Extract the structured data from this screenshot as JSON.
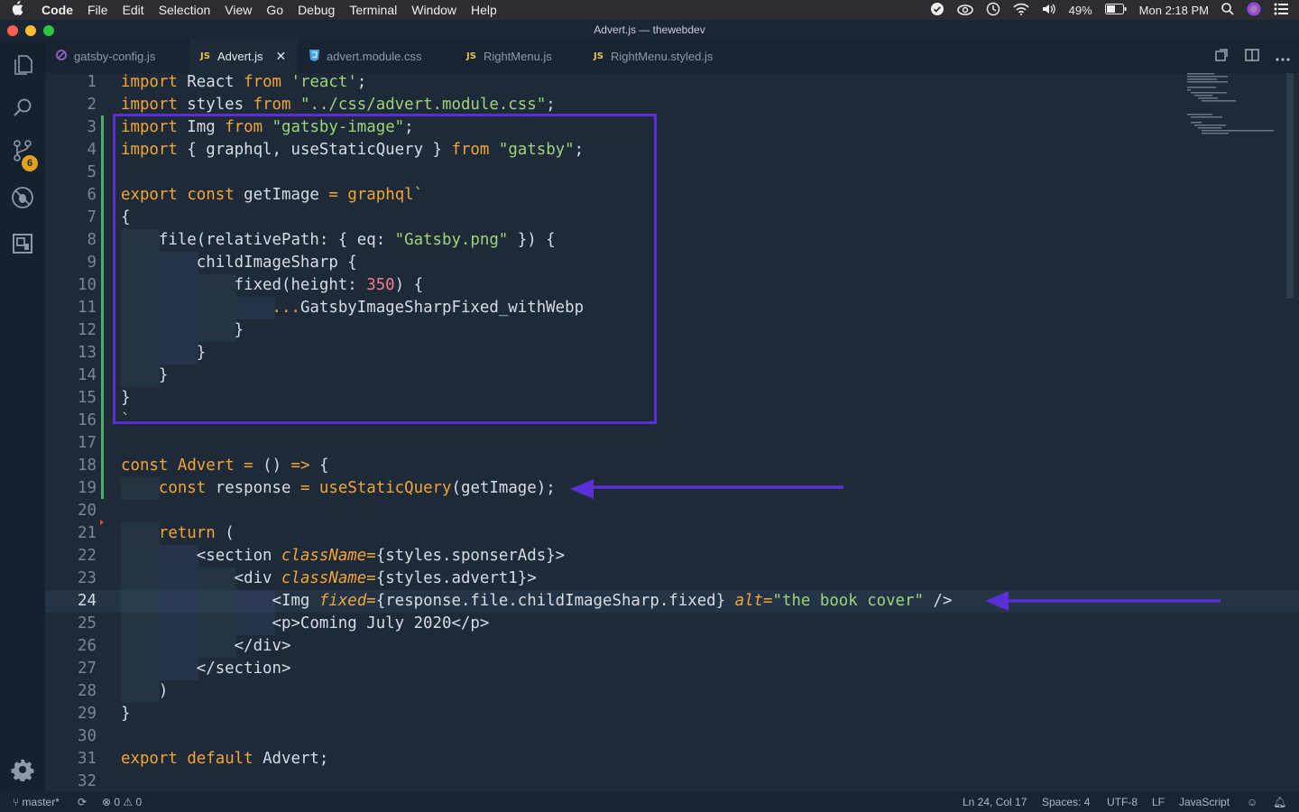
{
  "menubar": {
    "apple_icon": "apple-logo",
    "items": [
      "Code",
      "File",
      "Edit",
      "Selection",
      "View",
      "Go",
      "Debug",
      "Terminal",
      "Window",
      "Help"
    ],
    "battery": "49%",
    "clock": "Mon 2:18 PM"
  },
  "window": {
    "title": "Advert.js — thewebdev"
  },
  "activity": {
    "scm_badge": "6"
  },
  "tabs": [
    {
      "label": "gatsby-config.js",
      "icon": "gatsby-icon",
      "icon_text": ""
    },
    {
      "label": "Advert.js",
      "icon": "js-icon",
      "icon_text": "JS",
      "active": true
    },
    {
      "label": "advert.module.css",
      "icon": "css-icon",
      "icon_text": ""
    },
    {
      "label": "RightMenu.js",
      "icon": "js-icon",
      "icon_text": "JS"
    },
    {
      "label": "RightMenu.styled.js",
      "icon": "js-icon",
      "icon_text": "JS"
    }
  ],
  "editor": {
    "current_line": 24,
    "lines": [
      [
        [
          "kw",
          "import"
        ],
        [
          "plain",
          " React "
        ],
        [
          "kw",
          "from"
        ],
        [
          "plain",
          " "
        ],
        [
          "str",
          "'react'"
        ],
        [
          "plain",
          ";"
        ]
      ],
      [
        [
          "kw",
          "import"
        ],
        [
          "plain",
          " styles "
        ],
        [
          "kw",
          "from"
        ],
        [
          "plain",
          " "
        ],
        [
          "str",
          "\"../css/advert.module.css\""
        ],
        [
          "plain",
          ";"
        ]
      ],
      [
        [
          "kw",
          "import"
        ],
        [
          "plain",
          " Img "
        ],
        [
          "kw",
          "from"
        ],
        [
          "plain",
          " "
        ],
        [
          "str",
          "\"gatsby-image\""
        ],
        [
          "plain",
          ";"
        ]
      ],
      [
        [
          "kw",
          "import"
        ],
        [
          "plain",
          " { graphql, useStaticQuery } "
        ],
        [
          "kw",
          "from"
        ],
        [
          "plain",
          " "
        ],
        [
          "str",
          "\"gatsby\""
        ],
        [
          "plain",
          ";"
        ]
      ],
      [],
      [
        [
          "kw",
          "export"
        ],
        [
          "plain",
          " "
        ],
        [
          "kw",
          "const"
        ],
        [
          "plain",
          " getImage "
        ],
        [
          "kw",
          "="
        ],
        [
          "plain",
          " "
        ],
        [
          "fn",
          "graphql"
        ],
        [
          "str",
          "`"
        ]
      ],
      [
        [
          "plain",
          "{"
        ]
      ],
      [
        [
          "plain",
          "    file(relativePath: { eq: "
        ],
        [
          "str",
          "\"Gatsby.png\""
        ],
        [
          "plain",
          " }) {"
        ]
      ],
      [
        [
          "plain",
          "        childImageSharp {"
        ]
      ],
      [
        [
          "plain",
          "            fixed(height: "
        ],
        [
          "num",
          "350"
        ],
        [
          "plain",
          ") {"
        ]
      ],
      [
        [
          "plain",
          "                "
        ],
        [
          "kw",
          "..."
        ],
        [
          "plain",
          "GatsbyImageSharpFixed_withWebp"
        ]
      ],
      [
        [
          "plain",
          "            }"
        ]
      ],
      [
        [
          "plain",
          "        }"
        ]
      ],
      [
        [
          "plain",
          "    }"
        ]
      ],
      [
        [
          "plain",
          "}"
        ]
      ],
      [
        [
          "str",
          "`"
        ]
      ],
      [],
      [
        [
          "kw",
          "const"
        ],
        [
          "plain",
          " "
        ],
        [
          "fn",
          "Advert"
        ],
        [
          "plain",
          " "
        ],
        [
          "kw",
          "="
        ],
        [
          "plain",
          " () "
        ],
        [
          "kw",
          "=>"
        ],
        [
          "plain",
          " {"
        ]
      ],
      [
        [
          "plain",
          "    "
        ],
        [
          "kw",
          "const"
        ],
        [
          "plain",
          " response "
        ],
        [
          "kw",
          "="
        ],
        [
          "plain",
          " "
        ],
        [
          "fn",
          "useStaticQuery"
        ],
        [
          "plain",
          "(getImage);"
        ]
      ],
      [],
      [
        [
          "plain",
          "    "
        ],
        [
          "kw",
          "return"
        ],
        [
          "plain",
          " ("
        ]
      ],
      [
        [
          "plain",
          "        <section "
        ],
        [
          "attr",
          "className"
        ],
        [
          "kw",
          "="
        ],
        [
          "plain",
          "{styles.sponserAds}>"
        ]
      ],
      [
        [
          "plain",
          "            <div "
        ],
        [
          "attr",
          "className"
        ],
        [
          "kw",
          "="
        ],
        [
          "plain",
          "{styles.advert1}>"
        ]
      ],
      [
        [
          "plain",
          "                <Img "
        ],
        [
          "attr",
          "fixed"
        ],
        [
          "kw",
          "="
        ],
        [
          "plain",
          "{response.file.childImageSharp.fixed} "
        ],
        [
          "attr",
          "alt"
        ],
        [
          "kw",
          "="
        ],
        [
          "str",
          "\"the book cover\""
        ],
        [
          "plain",
          " />"
        ]
      ],
      [
        [
          "plain",
          "                <p>Coming July 2020</p>"
        ]
      ],
      [
        [
          "plain",
          "            </div>"
        ]
      ],
      [
        [
          "plain",
          "        </section>"
        ]
      ],
      [
        [
          "plain",
          "    )"
        ]
      ],
      [
        [
          "plain",
          "}"
        ]
      ],
      [],
      [
        [
          "kw",
          "export"
        ],
        [
          "plain",
          " "
        ],
        [
          "kw",
          "default"
        ],
        [
          "plain",
          " Advert;"
        ]
      ],
      []
    ]
  },
  "statusbar": {
    "branch": "master*",
    "errors": "0",
    "warnings": "0",
    "position": "Ln 24, Col 17",
    "spaces": "Spaces: 4",
    "encoding": "UTF-8",
    "eol": "LF",
    "language": "JavaScript"
  }
}
